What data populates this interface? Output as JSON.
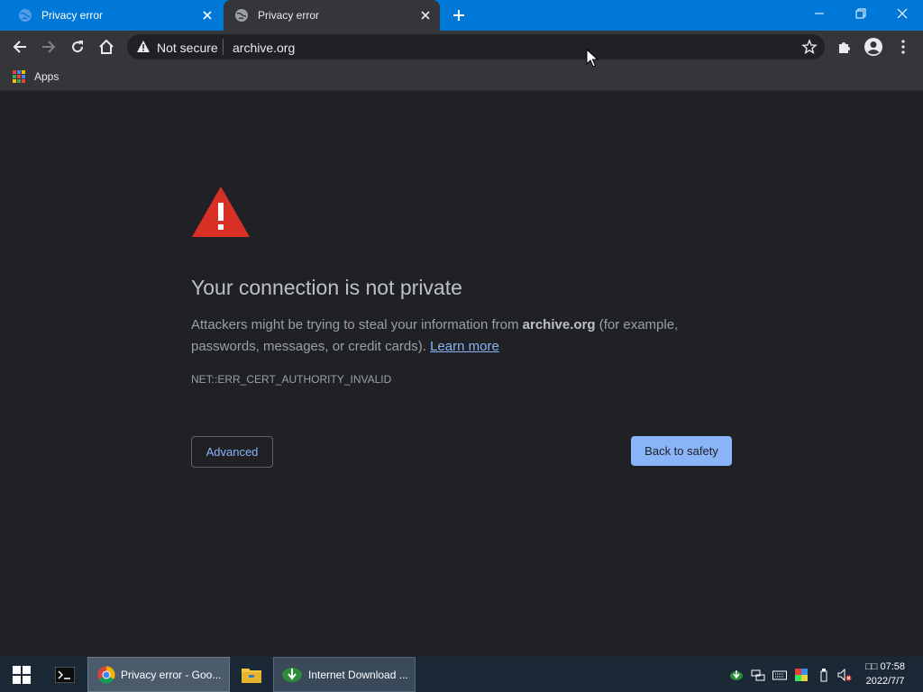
{
  "tabs": [
    {
      "title": "Privacy error",
      "favicon": "globe-icon",
      "active": false
    },
    {
      "title": "Privacy error",
      "favicon": "globe-icon",
      "active": true
    }
  ],
  "toolbar": {
    "security_label": "Not secure",
    "url": "archive.org"
  },
  "bookmarks": {
    "apps_label": "Apps"
  },
  "error_page": {
    "heading": "Your connection is not private",
    "desc_before": "Attackers might be trying to steal your information from ",
    "desc_domain": "archive.org",
    "desc_after": " (for example, passwords, messages, or credit cards). ",
    "learn_more": "Learn more",
    "error_code": "NET::ERR_CERT_AUTHORITY_INVALID",
    "advanced_button": "Advanced",
    "back_button": "Back to safety"
  },
  "taskbar": {
    "chrome_label": "Privacy error - Goo...",
    "idm_label": "Internet Download ...",
    "time": "□□ 07:58",
    "date": "2022/7/7"
  },
  "colors": {
    "titlebar": "#0078d7",
    "toolbar": "#35363a",
    "page_bg": "#202124",
    "warning_red": "#d93025",
    "link": "#8ab4f8",
    "primary_button": "#8ab4f8",
    "taskbar": "#1b2836"
  }
}
